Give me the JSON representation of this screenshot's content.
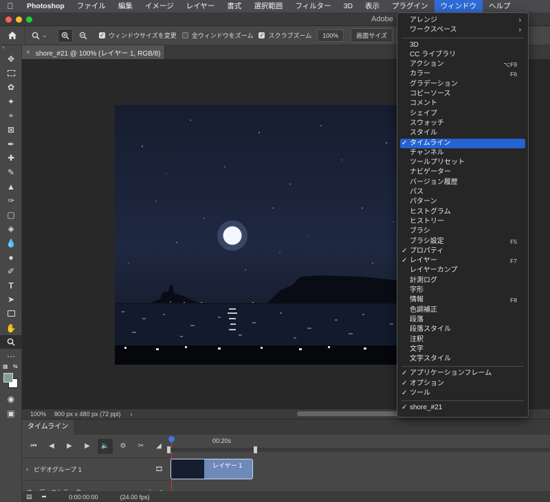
{
  "menubar": {
    "apple_icon": "apple-icon",
    "items": [
      "Photoshop",
      "ファイル",
      "編集",
      "イメージ",
      "レイヤー",
      "書式",
      "選択範囲",
      "フィルター",
      "3D",
      "表示",
      "プラグイン",
      "ウィンドウ",
      "ヘルプ"
    ],
    "active_index": 11
  },
  "window": {
    "title": "Adobe"
  },
  "options_bar": {
    "resize_windows": {
      "label": "ウィンドウサイズを変更",
      "checked": true
    },
    "zoom_all": {
      "label": "全ウィンドウをズーム",
      "checked": false
    },
    "scrubby_zoom": {
      "label": "スクラブズーム",
      "checked": true
    },
    "zoom_value": "100%",
    "fit_screen": "画面サイズ",
    "fill_screen": "画面"
  },
  "document": {
    "tab_title": "shore_#21 @ 100% (レイヤー 1, RGB/8)"
  },
  "status": {
    "zoom": "100%",
    "doc_info": "800 px x 480 px (72 ppi)",
    "arrow": "›"
  },
  "timeline": {
    "tab_label": "タイムライン",
    "ruler_label": "00:20s",
    "video_group": "ビデオグループ 1",
    "clip_label": "レイヤー 1",
    "audio_track": "オーディオトラック",
    "timecode": "0:00:00:00",
    "fps": "(24.00 fps)"
  },
  "window_menu": {
    "items": [
      {
        "label": "アレンジ",
        "submenu": true
      },
      {
        "label": "ワークスペース",
        "submenu": true
      },
      {
        "sep": true
      },
      {
        "label": "3D"
      },
      {
        "label": "CC ライブラリ"
      },
      {
        "label": "アクション",
        "shortcut": "⌥F9"
      },
      {
        "label": "カラー",
        "shortcut": "F6"
      },
      {
        "label": "グラデーション"
      },
      {
        "label": "コピーソース"
      },
      {
        "label": "コメント"
      },
      {
        "label": "シェイプ"
      },
      {
        "label": "スウォッチ"
      },
      {
        "label": "スタイル"
      },
      {
        "label": "タイムライン",
        "checked": true,
        "highlighted": true
      },
      {
        "label": "チャンネル"
      },
      {
        "label": "ツールプリセット"
      },
      {
        "label": "ナビゲーター"
      },
      {
        "label": "バージョン履歴"
      },
      {
        "label": "パス"
      },
      {
        "label": "パターン"
      },
      {
        "label": "ヒストグラム"
      },
      {
        "label": "ヒストリー"
      },
      {
        "label": "ブラシ"
      },
      {
        "label": "ブラシ設定",
        "shortcut": "F5"
      },
      {
        "label": "プロパティ",
        "checked": true
      },
      {
        "label": "レイヤー",
        "checked": true,
        "shortcut": "F7"
      },
      {
        "label": "レイヤーカンプ"
      },
      {
        "label": "計測ログ"
      },
      {
        "label": "字形"
      },
      {
        "label": "情報",
        "shortcut": "F8"
      },
      {
        "label": "色調補正"
      },
      {
        "label": "段落"
      },
      {
        "label": "段落スタイル"
      },
      {
        "label": "注釈"
      },
      {
        "label": "文字"
      },
      {
        "label": "文字スタイル"
      },
      {
        "sep": true
      },
      {
        "label": "アプリケーションフレーム",
        "checked": true
      },
      {
        "label": "オプション",
        "checked": true
      },
      {
        "label": "ツール",
        "checked": true
      },
      {
        "sep": true
      },
      {
        "label": "shore_#21",
        "checked": true
      }
    ]
  },
  "colors": {
    "menu_highlight": "#2463d1",
    "foreground_swatch": "#7fa091",
    "background_swatch": "#ffffff",
    "timeline_clip": "#6d8ab8"
  }
}
